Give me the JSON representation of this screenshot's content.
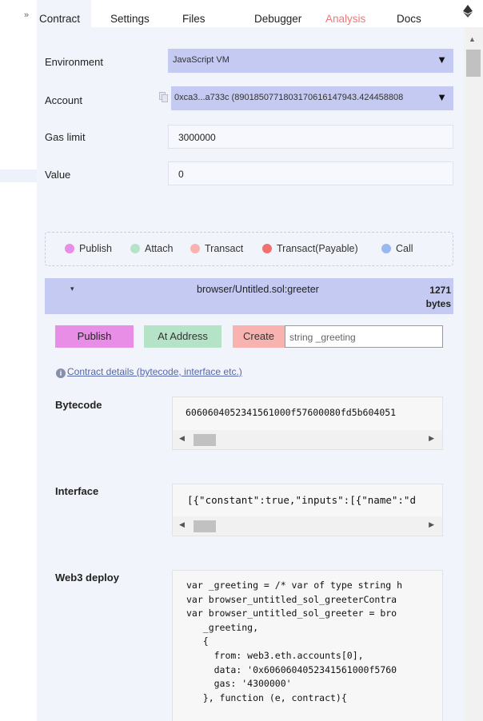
{
  "tabs": [
    {
      "label": "Contract"
    },
    {
      "label": "Settings"
    },
    {
      "label": "Files"
    },
    {
      "label": "Debugger"
    },
    {
      "label": "Analysis"
    },
    {
      "label": "Docs"
    }
  ],
  "colors": {
    "analysis_tab": "#f07878",
    "select_bg": "#c5caf3",
    "publish": "#e98ee6",
    "attach": "#b5e3c7",
    "transact": "#f8b3b0",
    "transact_payable": "#f07070",
    "call": "#9ab8f0"
  },
  "environment": {
    "label": "Environment",
    "value": "JavaScript VM"
  },
  "account": {
    "label": "Account",
    "value": "0xca3...a733c (89018507718031706161479​43.424458808"
  },
  "gas_limit": {
    "label": "Gas limit",
    "value": "3000000"
  },
  "value_field": {
    "label": "Value",
    "value": "0"
  },
  "legend": [
    {
      "label": "Publish",
      "color": "#e98ee6"
    },
    {
      "label": "Attach",
      "color": "#b5e3c7"
    },
    {
      "label": "Transact",
      "color": "#f8b3b0"
    },
    {
      "label": "Transact(Payable)",
      "color": "#f07070"
    },
    {
      "label": "Call",
      "color": "#9ab8f0"
    }
  ],
  "contract": {
    "name": "browser/Untitled.sol:greeter",
    "size_num": "1271",
    "size_unit": "bytes",
    "publish_label": "Publish",
    "at_address_label": "At Address",
    "create_label": "Create",
    "create_placeholder": "string _greeting",
    "details_link": "Contract details (bytecode, interface etc.)"
  },
  "bytecode": {
    "label": "Bytecode",
    "value": "6060604052341561000f57600080fd5b604051"
  },
  "interface": {
    "label": "Interface",
    "value": "[{\"constant\":true,\"inputs\":[{\"name\":\"d"
  },
  "web3deploy": {
    "label": "Web3 deploy",
    "lines": [
      "var _greeting = /* var of type string h",
      "var browser_untitled_sol_greeterContra",
      "var browser_untitled_sol_greeter = bro",
      "   _greeting,",
      "   {",
      "     from: web3.eth.accounts[0],",
      "     data: '0x6060604052341561000f5760",
      "     gas: '4300000'",
      "   }, function (e, contract){"
    ]
  }
}
